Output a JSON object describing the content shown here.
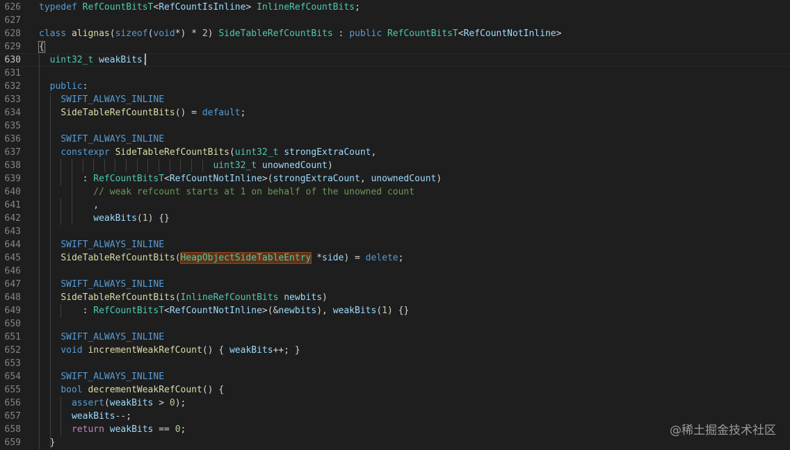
{
  "watermark": "@稀土掘金技术社区",
  "lines": [
    {
      "n": "626",
      "tokens": [
        [
          "typedef",
          "kw"
        ],
        [
          " ",
          ""
        ],
        [
          "RefCountBitsT",
          "ty"
        ],
        [
          "<",
          ""
        ],
        [
          "RefCountIsInline",
          "var"
        ],
        [
          "> ",
          ""
        ],
        [
          "InlineRefCountBits",
          "ty"
        ],
        [
          ";",
          ""
        ]
      ]
    },
    {
      "n": "627",
      "tokens": []
    },
    {
      "n": "628",
      "tokens": [
        [
          "class",
          "kw"
        ],
        [
          " ",
          ""
        ],
        [
          "alignas",
          "fn"
        ],
        [
          "(",
          ""
        ],
        [
          "sizeof",
          "kw"
        ],
        [
          "(",
          ""
        ],
        [
          "void",
          "kw"
        ],
        [
          "*) * ",
          ""
        ],
        [
          "2",
          "num"
        ],
        [
          ") ",
          ""
        ],
        [
          "SideTableRefCountBits",
          "ty"
        ],
        [
          " : ",
          ""
        ],
        [
          "public",
          "kw"
        ],
        [
          " ",
          ""
        ],
        [
          "RefCountBitsT",
          "ty"
        ],
        [
          "<",
          ""
        ],
        [
          "RefCountNotInline",
          "var"
        ],
        [
          ">",
          ""
        ]
      ]
    },
    {
      "n": "629",
      "tokens": [
        [
          "{",
          "bm"
        ]
      ]
    },
    {
      "n": "630",
      "tokens": [
        [
          "  ",
          ""
        ],
        [
          "uint32_t",
          "ty"
        ],
        [
          " ",
          ""
        ],
        [
          "weakBits",
          "var"
        ],
        [
          ";",
          ""
        ]
      ],
      "current": true
    },
    {
      "n": "631",
      "tokens": []
    },
    {
      "n": "632",
      "tokens": [
        [
          "  ",
          ""
        ],
        [
          "public",
          "kw"
        ],
        [
          ":",
          ""
        ]
      ]
    },
    {
      "n": "633",
      "tokens": [
        [
          "    ",
          ""
        ],
        [
          "SWIFT_ALWAYS_INLINE",
          "mac"
        ]
      ]
    },
    {
      "n": "634",
      "tokens": [
        [
          "    ",
          ""
        ],
        [
          "SideTableRefCountBits",
          "fn"
        ],
        [
          "() = ",
          ""
        ],
        [
          "default",
          "kw"
        ],
        [
          ";",
          ""
        ]
      ]
    },
    {
      "n": "635",
      "tokens": []
    },
    {
      "n": "636",
      "tokens": [
        [
          "    ",
          ""
        ],
        [
          "SWIFT_ALWAYS_INLINE",
          "mac"
        ]
      ]
    },
    {
      "n": "637",
      "tokens": [
        [
          "    ",
          ""
        ],
        [
          "constexpr",
          "kw"
        ],
        [
          " ",
          ""
        ],
        [
          "SideTableRefCountBits",
          "fn"
        ],
        [
          "(",
          ""
        ],
        [
          "uint32_t",
          "ty"
        ],
        [
          " ",
          ""
        ],
        [
          "strongExtraCount",
          "var"
        ],
        [
          ",",
          ""
        ]
      ]
    },
    {
      "n": "638",
      "tokens": [
        [
          "                                ",
          ""
        ],
        [
          "uint32_t",
          "ty"
        ],
        [
          " ",
          ""
        ],
        [
          "unownedCount",
          "var"
        ],
        [
          ")",
          ""
        ]
      ]
    },
    {
      "n": "639",
      "tokens": [
        [
          "        : ",
          ""
        ],
        [
          "RefCountBitsT",
          "ty"
        ],
        [
          "<",
          ""
        ],
        [
          "RefCountNotInline",
          "var"
        ],
        [
          ">(",
          ""
        ],
        [
          "strongExtraCount",
          "var"
        ],
        [
          ", ",
          ""
        ],
        [
          "unownedCount",
          "var"
        ],
        [
          ")",
          ""
        ]
      ]
    },
    {
      "n": "640",
      "tokens": [
        [
          "          ",
          ""
        ],
        [
          "// weak refcount starts at 1 on behalf of the unowned count",
          "cm"
        ]
      ]
    },
    {
      "n": "641",
      "tokens": [
        [
          "          ,",
          ""
        ]
      ]
    },
    {
      "n": "642",
      "tokens": [
        [
          "          ",
          ""
        ],
        [
          "weakBits",
          "var"
        ],
        [
          "(",
          ""
        ],
        [
          "1",
          "num"
        ],
        [
          ") {}",
          ""
        ]
      ]
    },
    {
      "n": "643",
      "tokens": []
    },
    {
      "n": "644",
      "tokens": [
        [
          "    ",
          ""
        ],
        [
          "SWIFT_ALWAYS_INLINE",
          "mac"
        ]
      ]
    },
    {
      "n": "645",
      "tokens": [
        [
          "    ",
          ""
        ],
        [
          "SideTableRefCountBits",
          "fn"
        ],
        [
          "(",
          ""
        ],
        [
          "HeapObjectSideTableEntry",
          "ty hl"
        ],
        [
          " *",
          ""
        ],
        [
          "side",
          "var"
        ],
        [
          ") = ",
          ""
        ],
        [
          "delete",
          "kw"
        ],
        [
          ";",
          ""
        ]
      ]
    },
    {
      "n": "646",
      "tokens": []
    },
    {
      "n": "647",
      "tokens": [
        [
          "    ",
          ""
        ],
        [
          "SWIFT_ALWAYS_INLINE",
          "mac"
        ]
      ]
    },
    {
      "n": "648",
      "tokens": [
        [
          "    ",
          ""
        ],
        [
          "SideTableRefCountBits",
          "fn"
        ],
        [
          "(",
          ""
        ],
        [
          "InlineRefCountBits",
          "ty"
        ],
        [
          " ",
          ""
        ],
        [
          "newbits",
          "var"
        ],
        [
          ")",
          ""
        ]
      ]
    },
    {
      "n": "649",
      "tokens": [
        [
          "        : ",
          ""
        ],
        [
          "RefCountBitsT",
          "ty"
        ],
        [
          "<",
          ""
        ],
        [
          "RefCountNotInline",
          "var"
        ],
        [
          ">(&",
          ""
        ],
        [
          "newbits",
          "var"
        ],
        [
          "), ",
          ""
        ],
        [
          "weakBits",
          "var"
        ],
        [
          "(",
          ""
        ],
        [
          "1",
          "num"
        ],
        [
          ") {}",
          ""
        ]
      ]
    },
    {
      "n": "650",
      "tokens": []
    },
    {
      "n": "651",
      "tokens": [
        [
          "    ",
          ""
        ],
        [
          "SWIFT_ALWAYS_INLINE",
          "mac"
        ]
      ]
    },
    {
      "n": "652",
      "tokens": [
        [
          "    ",
          ""
        ],
        [
          "void",
          "kw"
        ],
        [
          " ",
          ""
        ],
        [
          "incrementWeakRefCount",
          "fn"
        ],
        [
          "() { ",
          ""
        ],
        [
          "weakBits",
          "var"
        ],
        [
          "++; }",
          ""
        ]
      ]
    },
    {
      "n": "653",
      "tokens": []
    },
    {
      "n": "654",
      "tokens": [
        [
          "    ",
          ""
        ],
        [
          "SWIFT_ALWAYS_INLINE",
          "mac"
        ]
      ]
    },
    {
      "n": "655",
      "tokens": [
        [
          "    ",
          ""
        ],
        [
          "bool",
          "kw"
        ],
        [
          " ",
          ""
        ],
        [
          "decrementWeakRefCount",
          "fn"
        ],
        [
          "() {",
          ""
        ]
      ]
    },
    {
      "n": "656",
      "tokens": [
        [
          "      ",
          ""
        ],
        [
          "assert",
          "kw"
        ],
        [
          "(",
          ""
        ],
        [
          "weakBits",
          "var"
        ],
        [
          " > ",
          ""
        ],
        [
          "0",
          "num"
        ],
        [
          ");",
          ""
        ]
      ]
    },
    {
      "n": "657",
      "tokens": [
        [
          "      ",
          ""
        ],
        [
          "weakBits",
          "var"
        ],
        [
          "--;",
          ""
        ]
      ]
    },
    {
      "n": "658",
      "tokens": [
        [
          "      ",
          ""
        ],
        [
          "return",
          "ctl"
        ],
        [
          " ",
          ""
        ],
        [
          "weakBits",
          "var"
        ],
        [
          " == ",
          ""
        ],
        [
          "0",
          "num"
        ],
        [
          ";",
          ""
        ]
      ]
    },
    {
      "n": "659",
      "tokens": [
        [
          "  }",
          ""
        ]
      ]
    }
  ]
}
